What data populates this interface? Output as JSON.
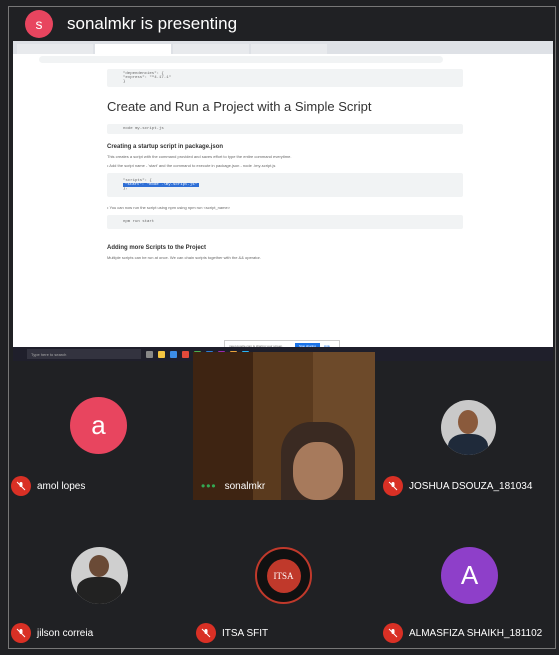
{
  "header": {
    "avatar_letter": "s",
    "presenter_text": "sonalmkr is presenting"
  },
  "shared_screen": {
    "tabs": [
      "",
      "",
      "",
      ""
    ],
    "url": "",
    "codebox1_lines": [
      "\"dependencies\": {",
      "  \"express\": \"^4.17.1\"",
      "}"
    ],
    "heading": "Create and Run a Project with a Simple Script",
    "codebox2": "node my-script.js",
    "subheading": "Creating a startup script in package.json",
    "para1": "This creates a script with the command provided and saves effort to type the entire command everytime.",
    "bullet1": "• Add the script name - 'start' and the command to execute in package.json - node .\\my-script.js",
    "code3_lines": [
      "\"scripts\": {",
      "\"start\": \"node .\\my-script.js\"",
      "},"
    ],
    "bullet2": "• You can now run the script using npm using npm run <script_name>",
    "code4": "npm run start",
    "subheading2": "Adding more Scripts to the Project",
    "para2": "Multiple scripts can be run at once. We can chain scripts together with the && operator.",
    "toast_text": "meet.google.com is sharing your screen.",
    "toast_stop": "Stop sharing",
    "toast_hide": "Hide",
    "taskbar_search": "Type here to search"
  },
  "participants": [
    {
      "name": "amol lopes",
      "avatar": "a",
      "color": "#e8455f"
    },
    {
      "name": "sonalmkr"
    },
    {
      "name": "JOSHUA DSOUZA_181034"
    },
    {
      "name": "jilson correia"
    },
    {
      "name": "ITSA SFIT"
    },
    {
      "name": "ALMASFIZA SHAIKH_181102",
      "avatar": "A",
      "color": "#8e3fc9"
    }
  ]
}
